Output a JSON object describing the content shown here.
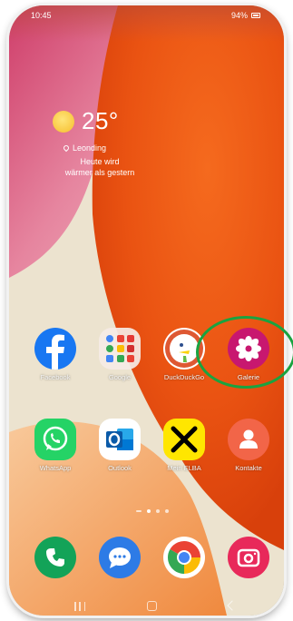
{
  "status_bar": {
    "time": "10:45",
    "battery": "94%"
  },
  "weather": {
    "temperature": "25°",
    "location": "Leonding",
    "description_line1": "Heute wird",
    "description_line2": "wärmer als gestern",
    "icon": "sun-icon"
  },
  "apps_row1": [
    {
      "label": "Facebook",
      "icon": "facebook-icon"
    },
    {
      "label": "Google",
      "icon": "google-folder-icon"
    },
    {
      "label": "DuckDuckGo",
      "icon": "duckduckgo-icon"
    },
    {
      "label": "Galerie",
      "icon": "gallery-icon"
    }
  ],
  "apps_row2": [
    {
      "label": "WhatsApp",
      "icon": "whatsapp-icon"
    },
    {
      "label": "Outlook",
      "icon": "outlook-icon"
    },
    {
      "label": "Mein ELBA",
      "icon": "raiffeisen-icon"
    },
    {
      "label": "Kontakte",
      "icon": "contacts-icon"
    }
  ],
  "dock": [
    {
      "icon": "phone-icon"
    },
    {
      "icon": "messages-icon"
    },
    {
      "icon": "chrome-icon"
    },
    {
      "icon": "camera-icon"
    }
  ],
  "colors": {
    "highlight_ring": "#1aa340",
    "wallpaper_orange": "#ee5614",
    "wallpaper_pink": "#e48aa6",
    "wallpaper_cream": "#ece3cf"
  }
}
